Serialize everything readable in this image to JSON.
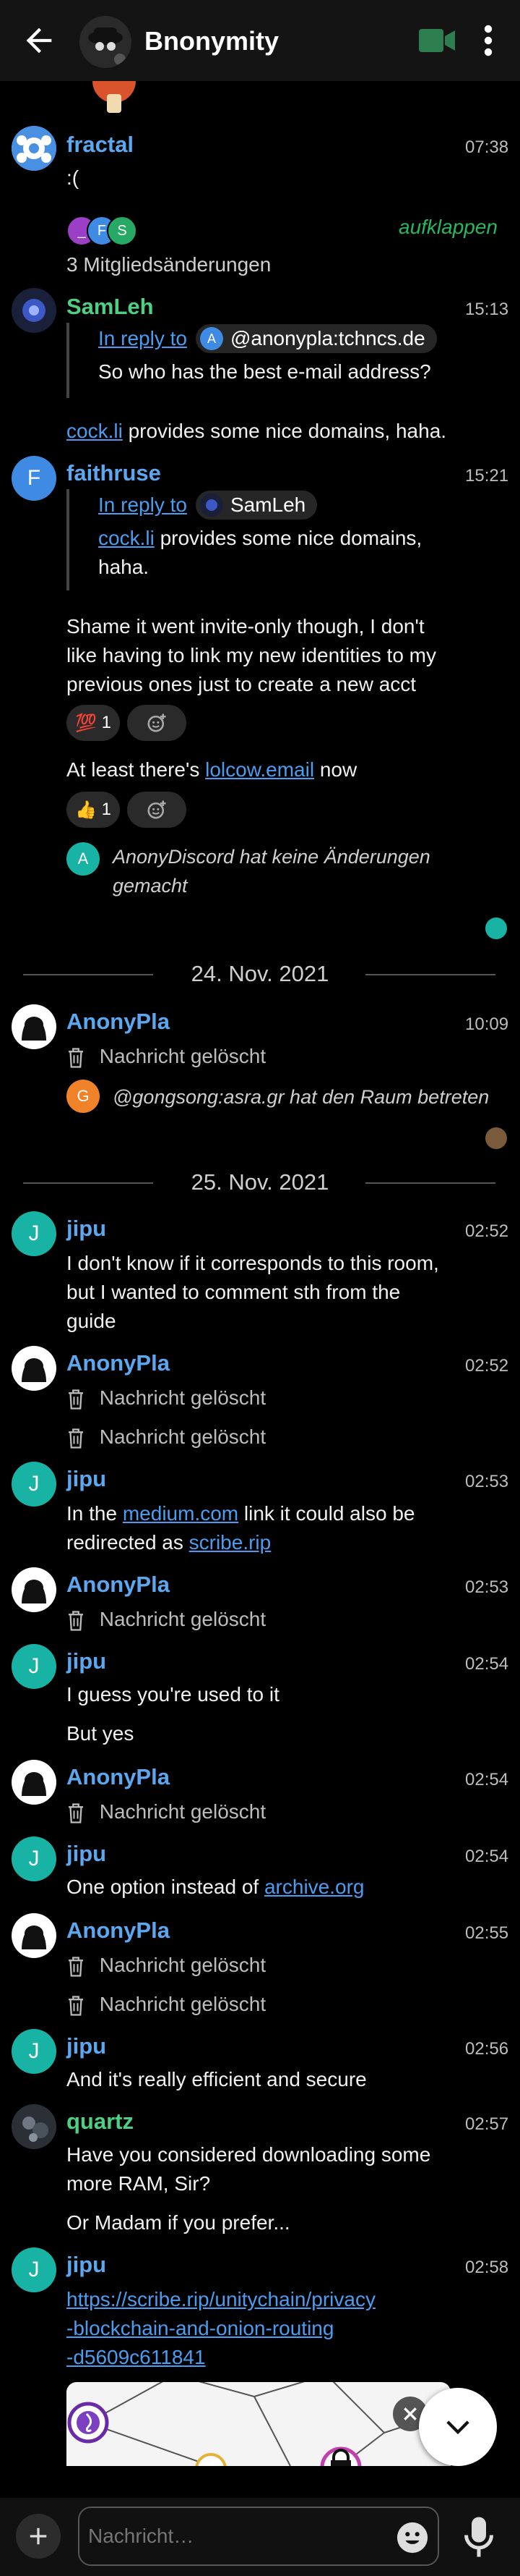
{
  "appbar": {
    "title": "Bnonymity"
  },
  "events": {
    "fractal_sender": "fractal",
    "fractal_time": "07:38",
    "fractal_msg": ":(",
    "member_avatars": [
      "_",
      "F",
      "S"
    ],
    "expand_label": "aufklappen",
    "member_changes": "3 Mitgliedsänderungen",
    "samleh_sender": "SamLeh",
    "samleh_time": "15:13",
    "samleh_reply_prefix": "In reply to",
    "samleh_reply_user_initial": "A",
    "samleh_reply_user": "@anonypla:tchncs.de",
    "samleh_reply_text": "So who has the best e-mail address?",
    "samleh_msg_link": "cock.li",
    "samleh_msg_rest": " provides some nice domains, haha.",
    "faith_sender": "faithruse",
    "faith_initial": "F",
    "faith_time": "15:21",
    "faith_reply_prefix": "In reply to",
    "faith_reply_user": "SamLeh",
    "faith_reply_link": "cock.li",
    "faith_reply_rest1": " provides some nice domains,",
    "faith_reply_rest2": "haha.",
    "faith_msg1_l1": "Shame it went invite-only though, I don't",
    "faith_msg1_l2": "like having to link my new identities to my",
    "faith_msg1_l3": "previous ones just to create a new acct",
    "faith_react1_emoji": "💯",
    "faith_react1_count": "1",
    "faith_msg2_prefix": "At least there's ",
    "faith_msg2_link": "lolcow.email",
    "faith_msg2_suffix": " now",
    "faith_react2_emoji": "👍",
    "faith_react2_count": "1",
    "sys1_initial": "A",
    "sys1_l1": "AnonyDiscord hat keine Änderungen",
    "sys1_l2": "gemacht",
    "date1": "24. Nov. 2021",
    "anony_sender": "AnonyPla",
    "deleted_label": "Nachricht gelöscht",
    "anony1_time": "10:09",
    "sys2_initial": "G",
    "sys2_text": "@gongsong:asra.gr hat den Raum betreten",
    "date2": "25. Nov. 2021",
    "jipu_sender": "jipu",
    "jipu_initial": "J",
    "jipu1_time": "02:52",
    "jipu1_l1": "I don't know if it corresponds to this room,",
    "jipu1_l2": "but I wanted to comment sth from the",
    "jipu1_l3": "guide",
    "anony2_time": "02:52",
    "jipu2_time": "02:53",
    "jipu2_a": "In the ",
    "jipu2_link1": "medium.com",
    "jipu2_b": " link it could also be",
    "jipu2_c": "redirected as ",
    "jipu2_link2": "scribe.rip",
    "anony3_time": "02:53",
    "jipu3_time": "02:54",
    "jipu3_l1": "I guess you're used to it",
    "jipu3_l2": "But yes",
    "anony4_time": "02:54",
    "jipu4_time": "02:54",
    "jipu4_a": "One option instead of ",
    "jipu4_link": "archive.org",
    "anony5_time": "02:55",
    "jipu5_time": "02:56",
    "jipu5_text": "And it's really efficient and secure",
    "quartz_sender": "quartz",
    "quartz_time": "02:57",
    "quartz_l1": "Have you considered downloading some",
    "quartz_l2": "more RAM, Sir?",
    "quartz_l3": "Or Madam if you prefer...",
    "jipu6_time": "02:58",
    "jipu6_link1": "https://scribe.rip/unitychain/privacy",
    "jipu6_link2": "-blockchain-and-onion-routing",
    "jipu6_link3": "-d5609c611841"
  },
  "composer": {
    "placeholder": "Nachricht…"
  },
  "colors": {
    "background": "#000000",
    "sender_blue": "#5ba8f0",
    "sender_green": "#4dcf84",
    "link": "#4a9df0",
    "accent_teal": "#19b3a6",
    "expand_green": "#27b85f"
  },
  "icons": [
    "back-arrow-icon",
    "video-call-icon",
    "more-vert-icon",
    "trash-icon",
    "add-reaction-icon",
    "chevron-down-icon",
    "plus-icon",
    "emoji-icon",
    "mic-icon",
    "close-icon"
  ]
}
